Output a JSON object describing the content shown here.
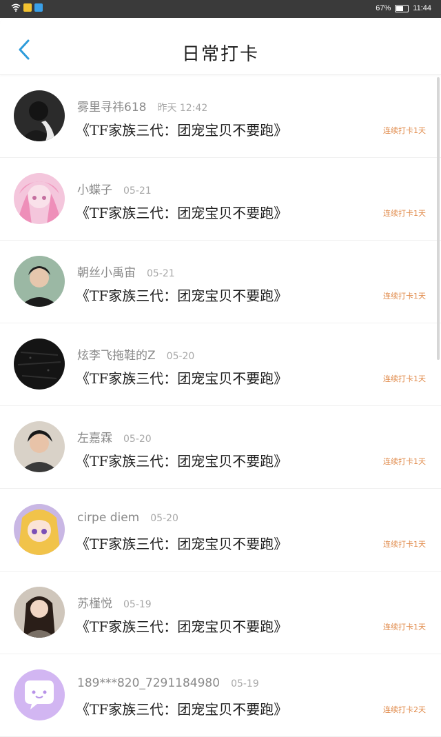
{
  "status_bar": {
    "battery_percent": "67%",
    "battery_level": 0.67,
    "time": "11:44"
  },
  "header": {
    "title": "日常打卡",
    "back_label": "返回"
  },
  "colors": {
    "accent": "#2d9cdb",
    "badge": "#e08a4a"
  },
  "checkins": [
    {
      "name": "雾里寻祎618",
      "date": "昨天 12:42",
      "content": "《TF家族三代：团宠宝贝不要跑》",
      "badge": "连续打卡1天",
      "avatar": "dark-portrait"
    },
    {
      "name": "小蝶子",
      "date": "05-21",
      "content": "《TF家族三代：团宠宝贝不要跑》",
      "badge": "连续打卡1天",
      "avatar": "pink-anime"
    },
    {
      "name": "朝丝小禹宙",
      "date": "05-21",
      "content": "《TF家族三代：团宠宝贝不要跑》",
      "badge": "连续打卡1天",
      "avatar": "boy-portrait"
    },
    {
      "name": "炫李飞拖鞋的Z",
      "date": "05-20",
      "content": "《TF家族三代：团宠宝贝不要跑》",
      "badge": "连续打卡1天",
      "avatar": "black-texture"
    },
    {
      "name": "左嘉霖",
      "date": "05-20",
      "content": "《TF家族三代：团宠宝贝不要跑》",
      "badge": "连续打卡1天",
      "avatar": "boy-portrait-2"
    },
    {
      "name": "cirpe diem",
      "date": "05-20",
      "content": "《TF家族三代：团宠宝贝不要跑》",
      "badge": "连续打卡1天",
      "avatar": "anime-girl"
    },
    {
      "name": "苏槿悦",
      "date": "05-19",
      "content": "《TF家族三代：团宠宝贝不要跑》",
      "badge": "连续打卡1天",
      "avatar": "girl-portrait"
    },
    {
      "name": "189***820_7291184980",
      "date": "05-19",
      "content": "《TF家族三代：团宠宝贝不要跑》",
      "badge": "连续打卡2天",
      "avatar": "default-chat"
    }
  ]
}
